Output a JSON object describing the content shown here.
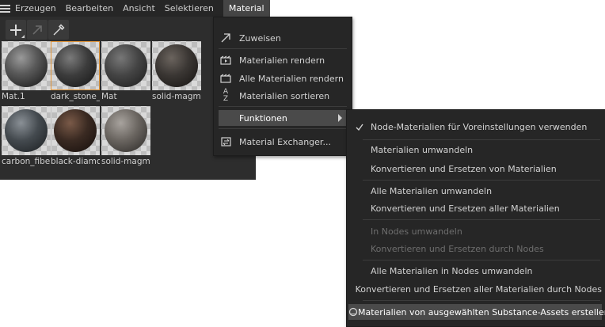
{
  "menubar": {
    "items": [
      "Erzeugen",
      "Bearbeiten",
      "Ansicht",
      "Selektieren",
      "Material"
    ]
  },
  "toolbar": {
    "tools": [
      "plus-icon",
      "arrow-icon",
      "eyedropper-icon"
    ]
  },
  "materials": [
    {
      "label": "Mat.1",
      "color": "#555555"
    },
    {
      "label": "dark_stone_",
      "color": "#3c3c3c"
    },
    {
      "label": "Mat",
      "color": "#444444"
    },
    {
      "label": "solid-magm",
      "color": "#3a3633"
    },
    {
      "label": "carbon_fibe",
      "color": "#444a4f"
    },
    {
      "label": "black-diamc",
      "color": "#3a2a22"
    },
    {
      "label": "solid-magm",
      "color": "#6a6560"
    }
  ],
  "material_menu": {
    "assign": "Zuweisen",
    "render_materials": "Materialien rendern",
    "render_all": "Alle Materialien rendern",
    "sort": "Materialien sortieren",
    "functions": "Funktionen",
    "exchanger": "Material Exchanger..."
  },
  "functions_submenu": {
    "node_default": "Node-Materialien für Voreinstellungen verwenden",
    "convert": "Materialien umwandeln",
    "convert_replace": "Konvertieren und Ersetzen von Materialien",
    "convert_all": "Alle Materialien umwandeln",
    "convert_replace_all": "Konvertieren und Ersetzen aller Materialien",
    "to_nodes": "In Nodes umwandeln",
    "replace_by_nodes": "Konvertieren und Ersetzen durch Nodes",
    "all_to_nodes": "Alle Materialien in Nodes umwandeln",
    "replace_all_by_nodes": "Konvertieren und Ersetzen aller Materialien durch Nodes",
    "from_substance": "Materialien von ausgewählten Substance-Assets erstellen"
  },
  "colors": {
    "selected_border": "#e0953a",
    "menu_bg": "#262626",
    "highlight_bg": "#4a4a4a"
  }
}
